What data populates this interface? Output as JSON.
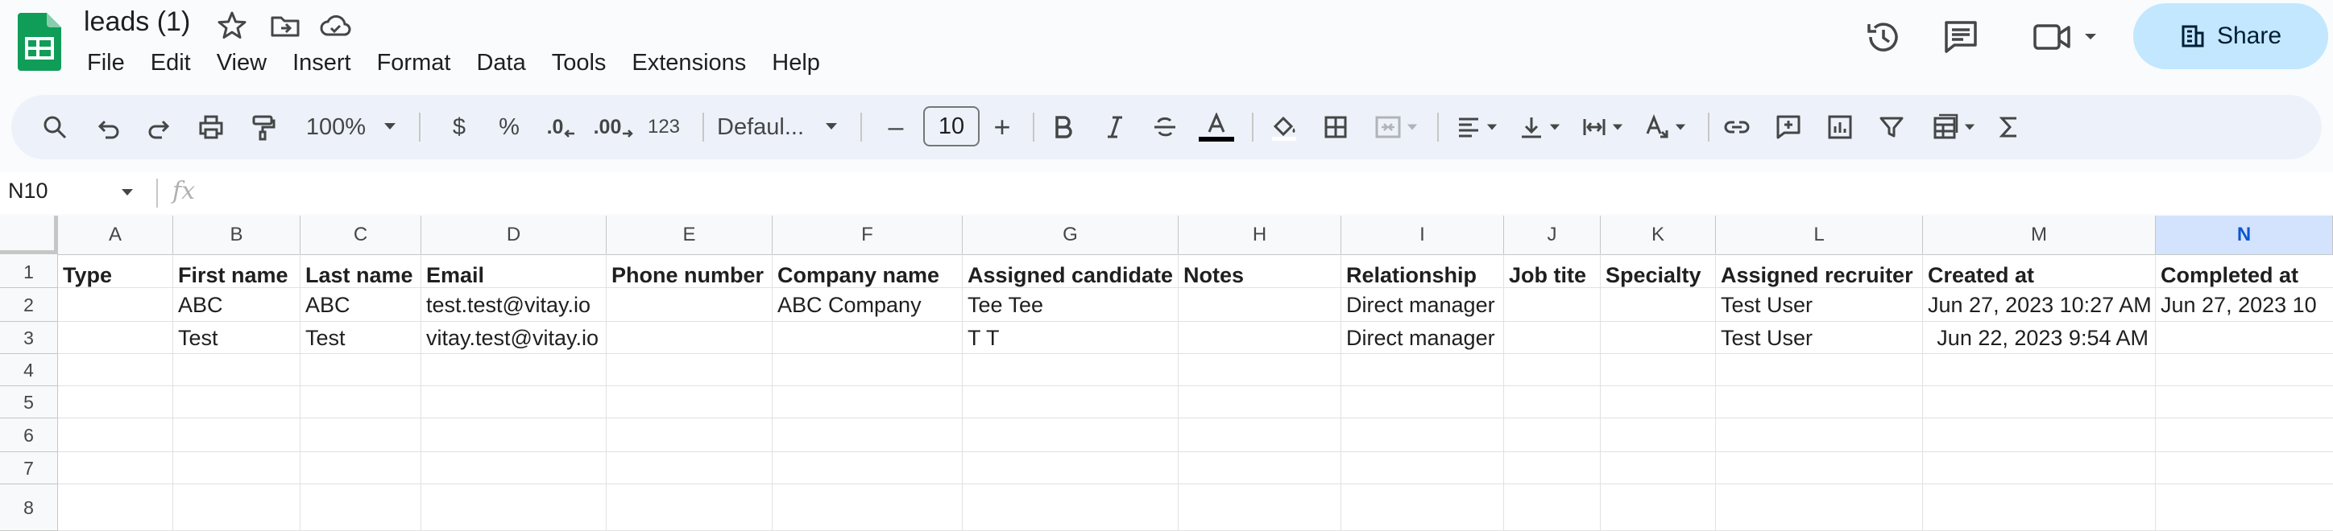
{
  "doc": {
    "title": "leads (1)"
  },
  "menus": [
    "File",
    "Edit",
    "View",
    "Insert",
    "Format",
    "Data",
    "Tools",
    "Extensions",
    "Help"
  ],
  "share": {
    "label": "Share"
  },
  "toolbar": {
    "zoom": "100%",
    "currency": "$",
    "percent": "%",
    "dec_decrease": ".0",
    "dec_increase": ".00",
    "more_formats": "123",
    "font": "Defaul...",
    "font_size": "10",
    "minus": "–",
    "plus": "+"
  },
  "formula": {
    "name_box": "N10",
    "fx": "fx"
  },
  "colors": {
    "accent": "#0b57d0",
    "share_bg": "#c2e7ff",
    "sheets_green": "#0f9d58"
  },
  "grid": {
    "columns": [
      "A",
      "B",
      "C",
      "D",
      "E",
      "F",
      "G",
      "H",
      "I",
      "J",
      "K",
      "L",
      "M",
      "N"
    ],
    "selected_column": "N",
    "row_numbers": [
      "1",
      "2",
      "3",
      "4",
      "5",
      "6",
      "7",
      "8"
    ],
    "rows": [
      [
        "Type",
        "First name",
        "Last name",
        "Email",
        "Phone number",
        "Company name",
        "Assigned candidate",
        "Notes",
        "Relationship",
        "Job tite",
        "Specialty",
        "Assigned recruiter",
        "Created at",
        "Completed at"
      ],
      [
        "",
        "ABC",
        "ABC",
        "test.test@vitay.io",
        "",
        "ABC Company",
        "Tee Tee",
        "",
        "Direct manager",
        "",
        "",
        "Test User",
        "Jun 27, 2023 10:27 AM",
        "Jun 27, 2023 10"
      ],
      [
        "",
        "Test",
        "Test",
        "vitay.test@vitay.io",
        "",
        "",
        "T T",
        "",
        "Direct manager",
        "",
        "",
        "Test User",
        "Jun 22, 2023 9:54 AM",
        ""
      ],
      [
        "",
        "",
        "",
        "",
        "",
        "",
        "",
        "",
        "",
        "",
        "",
        "",
        "",
        ""
      ],
      [
        "",
        "",
        "",
        "",
        "",
        "",
        "",
        "",
        "",
        "",
        "",
        "",
        "",
        ""
      ],
      [
        "",
        "",
        "",
        "",
        "",
        "",
        "",
        "",
        "",
        "",
        "",
        "",
        "",
        ""
      ],
      [
        "",
        "",
        "",
        "",
        "",
        "",
        "",
        "",
        "",
        "",
        "",
        "",
        "",
        ""
      ],
      [
        "",
        "",
        "",
        "",
        "",
        "",
        "",
        "",
        "",
        "",
        "",
        "",
        "",
        ""
      ]
    ]
  }
}
